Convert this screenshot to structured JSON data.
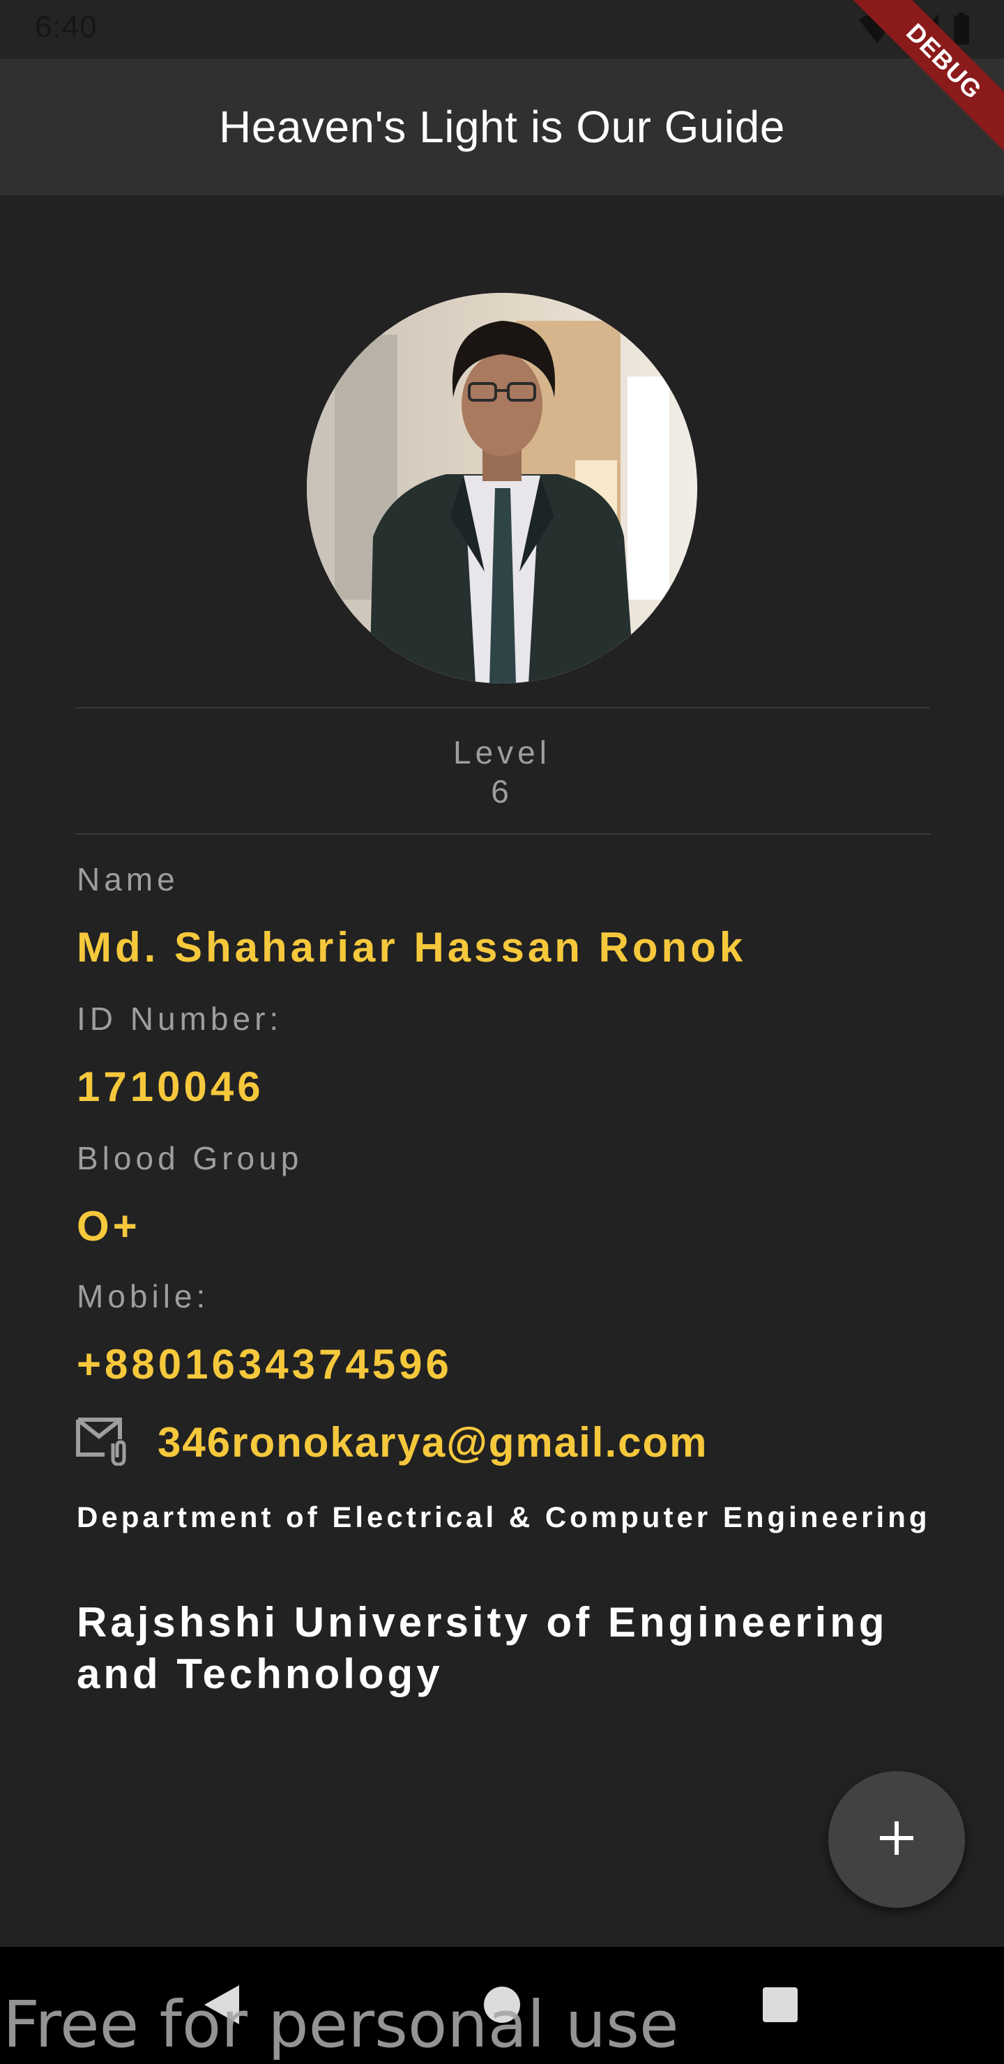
{
  "status_bar": {
    "time": "6:40",
    "icons": [
      "wifi-icon",
      "signal-icon",
      "battery-icon"
    ]
  },
  "app_bar": {
    "title": "Heaven's Light is Our Guide"
  },
  "debug_banner": {
    "label": "DEBUG",
    "color": "#8b1a1a"
  },
  "profile": {
    "avatar_alt": "profile-photo",
    "level_label": "Level",
    "level_value": "6",
    "name_label": "Name",
    "name_value": "Md. Shahariar Hassan Ronok",
    "id_label": "ID Number:",
    "id_value": "1710046",
    "blood_label": "Blood Group",
    "blood_value": "O+",
    "mobile_label": "Mobile:",
    "mobile_value": "+8801634374596",
    "email_icon": "email-attachment-icon",
    "email_value": "346ronokarya@gmail.com",
    "department": "Department of Electrical & Computer Engineering",
    "university": "Rajshshi University of Engineering and Technology"
  },
  "fab": {
    "icon": "plus-icon"
  },
  "nav_bar": {
    "buttons": [
      "back-icon",
      "home-icon",
      "recents-icon"
    ]
  },
  "watermark": "Free for personal use",
  "colors": {
    "background": "#222223",
    "app_bar": "#303031",
    "accent": "#f6c83c",
    "label": "#9e9e9e",
    "fab": "#424243"
  }
}
